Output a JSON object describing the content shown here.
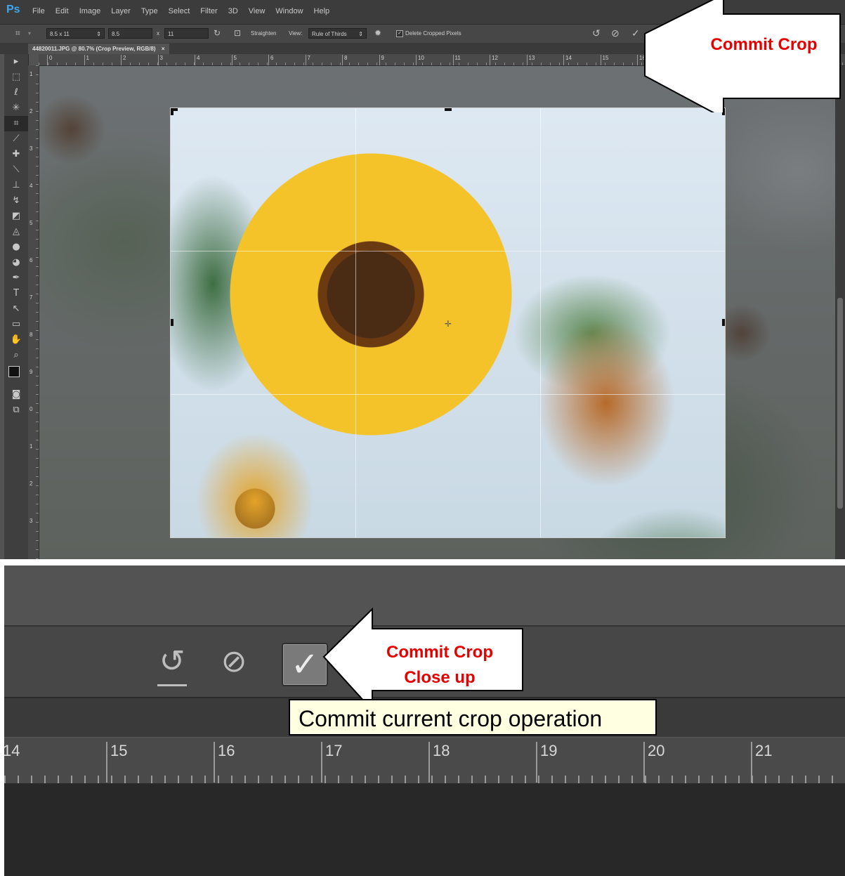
{
  "app": {
    "logo": "Ps",
    "menu": [
      "File",
      "Edit",
      "Image",
      "Layer",
      "Type",
      "Select",
      "Filter",
      "3D",
      "View",
      "Window",
      "Help"
    ]
  },
  "options_bar": {
    "preset": "8.5 x 11",
    "width": "8.5",
    "times": "x",
    "height": "11",
    "straighten": "Straighten",
    "view_label": "View:",
    "view_value": "Rule of Thirds",
    "delete_cropped": "Delete Cropped Pixels"
  },
  "document_tab": {
    "title": "44820011.JPG @ 80.7% (Crop Preview, RGB/8)",
    "close": "×"
  },
  "ruler_h": [
    "0",
    "1",
    "2",
    "3",
    "4",
    "5",
    "6",
    "7",
    "8",
    "9",
    "10",
    "11",
    "12",
    "13",
    "14",
    "15",
    "16"
  ],
  "ruler_v": [
    "1",
    "2",
    "3",
    "4",
    "5",
    "6",
    "7",
    "8",
    "9",
    "0",
    "1",
    "2",
    "3"
  ],
  "tools": [
    "move-tool",
    "marquee-tool",
    "lasso-tool",
    "magic-wand-tool",
    "crop-tool",
    "eyedropper-tool",
    "healing-tool",
    "brush-tool",
    "stamp-tool",
    "history-brush-tool",
    "eraser-tool",
    "gradient-tool",
    "blur-tool",
    "dodge-tool",
    "pen-tool",
    "type-tool",
    "path-select-tool",
    "shape-tool",
    "hand-tool",
    "zoom-tool"
  ],
  "annotations": {
    "top_callout": "Commit Crop",
    "bottom_callout_line1": "Commit Crop",
    "bottom_callout_line2": "Close up",
    "color": "#e60000"
  },
  "closeup": {
    "tooltip": "Commit current crop operation",
    "ruler": [
      "14",
      "15",
      "16",
      "17",
      "18",
      "19",
      "20",
      "21"
    ]
  }
}
